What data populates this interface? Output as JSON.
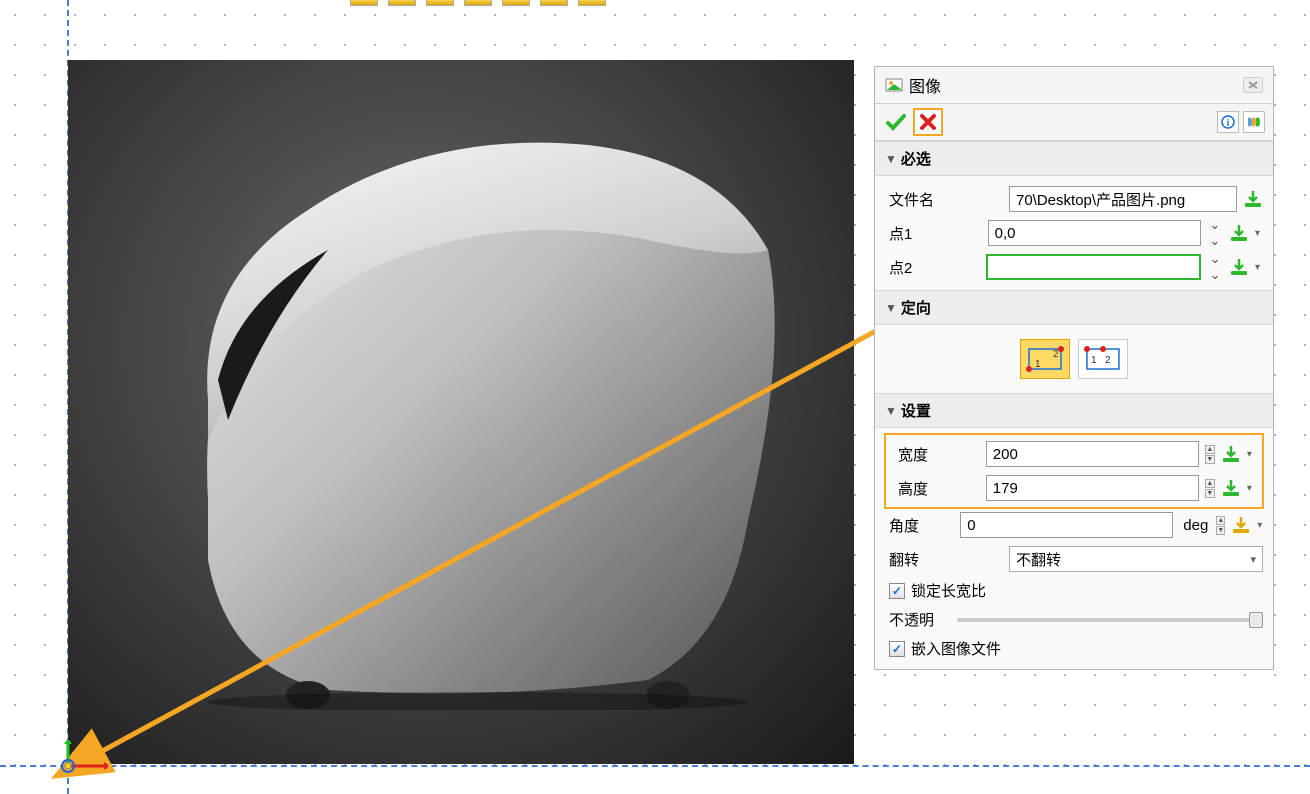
{
  "panel": {
    "title": "图像",
    "sections": {
      "required": {
        "label": "必选",
        "filename_label": "文件名",
        "filename_value": "70\\Desktop\\产品图片.png",
        "point1_label": "点1",
        "point1_value": "0,0",
        "point2_label": "点2",
        "point2_value": ""
      },
      "orient": {
        "label": "定向"
      },
      "settings": {
        "label": "设置",
        "width_label": "宽度",
        "width_value": "200",
        "height_label": "高度",
        "height_value": "179",
        "angle_label": "角度",
        "angle_value": "0",
        "angle_unit": "deg",
        "flip_label": "翻转",
        "flip_value": "不翻转",
        "lock_aspect_label": "锁定长宽比",
        "opacity_label": "不透明",
        "embed_label": "嵌入图像文件"
      }
    }
  },
  "colors": {
    "highlight": "#f5a623",
    "green_download": "#2eb82e",
    "yellow_download": "#e0a800",
    "blue_dash": "#4a7ed0"
  }
}
